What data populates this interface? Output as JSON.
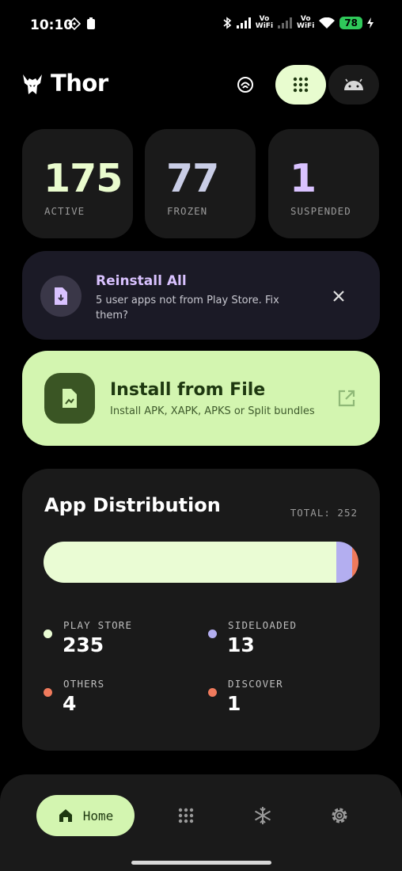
{
  "status_bar": {
    "time": "10:10",
    "vowifi_1": "Vo\nWiFi",
    "vowifi_2": "Vo\nWiFi",
    "battery": "78"
  },
  "header": {
    "title": "Thor",
    "logo_icon": "horned-helmet-icon",
    "buttons": [
      "shield-icon",
      "grid-icon",
      "android-icon"
    ]
  },
  "stats": [
    {
      "value": "175",
      "label": "ACTIVE",
      "color": "#eafcce"
    },
    {
      "value": "77",
      "label": "FROZEN",
      "color": "#c9cde6"
    },
    {
      "value": "1",
      "label": "SUSPENDED",
      "color": "#d9c2ff"
    }
  ],
  "reinstall": {
    "title": "Reinstall All",
    "subtitle": "5 user apps not from Play Store. Fix them?"
  },
  "install": {
    "title": "Install from File",
    "subtitle": "Install APK, XAPK, APKS or Split bundles"
  },
  "distribution": {
    "title": "App Distribution",
    "total": "TOTAL: 252",
    "segments": [
      {
        "name": "PLAY STORE",
        "value": 235,
        "display": "235",
        "color": "#eafcd4"
      },
      {
        "name": "SIDELOADED",
        "value": 13,
        "display": "13",
        "color": "#b3aef0"
      },
      {
        "name": "OTHERS",
        "value": 4,
        "display": "4",
        "color": "#ef7a5c"
      },
      {
        "name": "DISCOVER",
        "value": 1,
        "display": "1",
        "color": "#ef7a5c"
      }
    ]
  },
  "nav": {
    "home_label": "Home",
    "items": [
      "home-icon",
      "apps-grid-icon",
      "snowflake-icon",
      "settings-icon"
    ]
  }
}
